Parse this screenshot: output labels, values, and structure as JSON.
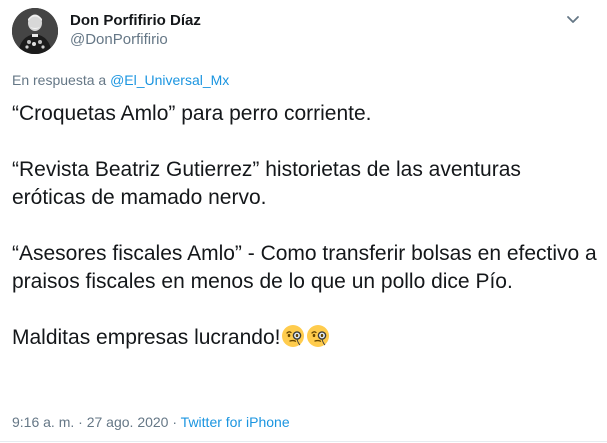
{
  "author": {
    "display_name": "Don Porfifirio Díaz",
    "handle": "@DonPorfifirio"
  },
  "reply": {
    "prefix": "En respuesta a ",
    "mention": "@El_Universal_Mx"
  },
  "tweet": {
    "lines": [
      "“Croquetas Amlo” para perro corriente.",
      "“Revista Beatriz Gutierrez” historietas de las aventuras eróticas de mamado nervo.",
      "“Asesores fiscales Amlo” - Como transferir bolsas en efectivo a praisos fiscales en menos de lo que un pollo dice Pío.",
      "Malditas empresas lucrando!"
    ],
    "emoji": [
      "face-with-monocle-icon",
      "face-with-monocle-icon"
    ]
  },
  "meta": {
    "time": "9:16 a. m.",
    "separator1": " · ",
    "date": "27 ago. 2020",
    "separator2": " · ",
    "source": "Twitter for iPhone"
  },
  "colors": {
    "text": "#14171a",
    "secondary": "#657786",
    "link": "#1b95e0",
    "divider": "#e6ecf0"
  },
  "icons": {
    "caret": "chevron-down-icon",
    "avatar": "avatar"
  }
}
